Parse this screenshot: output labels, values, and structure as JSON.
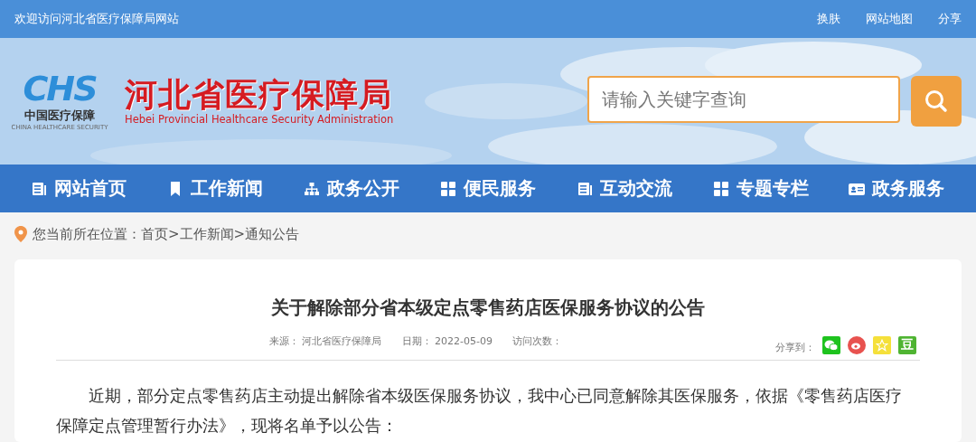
{
  "top_bar": {
    "welcome": "欢迎访问河北省医疗保障局网站",
    "links": [
      "换肤",
      "网站地图",
      "分享"
    ]
  },
  "header": {
    "logo": {
      "mark": "CHS",
      "cn": "中国医疗保障",
      "en": "CHINA HEALTHCARE SECURITY"
    },
    "site_name": "河北省医疗保障局",
    "site_name_en": "Hebei Provincial Healthcare Security Administration",
    "search": {
      "placeholder": "请输入关键字查询"
    }
  },
  "nav": [
    {
      "label": "网站首页",
      "kind": "doc"
    },
    {
      "label": "工作新闻",
      "kind": "bookmark"
    },
    {
      "label": "政务公开",
      "kind": "sitemap"
    },
    {
      "label": "便民服务",
      "kind": "grid"
    },
    {
      "label": "互动交流",
      "kind": "doc"
    },
    {
      "label": "专题专栏",
      "kind": "grid"
    },
    {
      "label": "政务服务",
      "kind": "card"
    }
  ],
  "breadcrumb": {
    "prefix": "您当前所在位置：",
    "items": [
      "首页",
      ">",
      "工作新闻",
      ">",
      "通知公告"
    ]
  },
  "article": {
    "title": "关于解除部分省本级定点零售药店医保服务协议的公告",
    "meta": [
      {
        "label": "来源：",
        "value": "河北省医疗保障局"
      },
      {
        "label": "日期：",
        "value": "2022-05-09"
      },
      {
        "label": "访问次数："
      }
    ],
    "share_label": "分享到：",
    "share": [
      {
        "kind": "wechat",
        "color": "#1ec31e"
      },
      {
        "kind": "weibo",
        "color": "#e8524f"
      },
      {
        "kind": "qzone",
        "color": "#f5e03a"
      },
      {
        "kind": "douban",
        "color": "#4fb432",
        "glyph": "豆"
      }
    ],
    "paragraph": "近期，部分定点零售药店主动提出解除省本级医保服务协议，我中心已同意解除其医保服务，依据《零售药店医疗保障定点管理暂行办法》，现将名单予以公告："
  }
}
